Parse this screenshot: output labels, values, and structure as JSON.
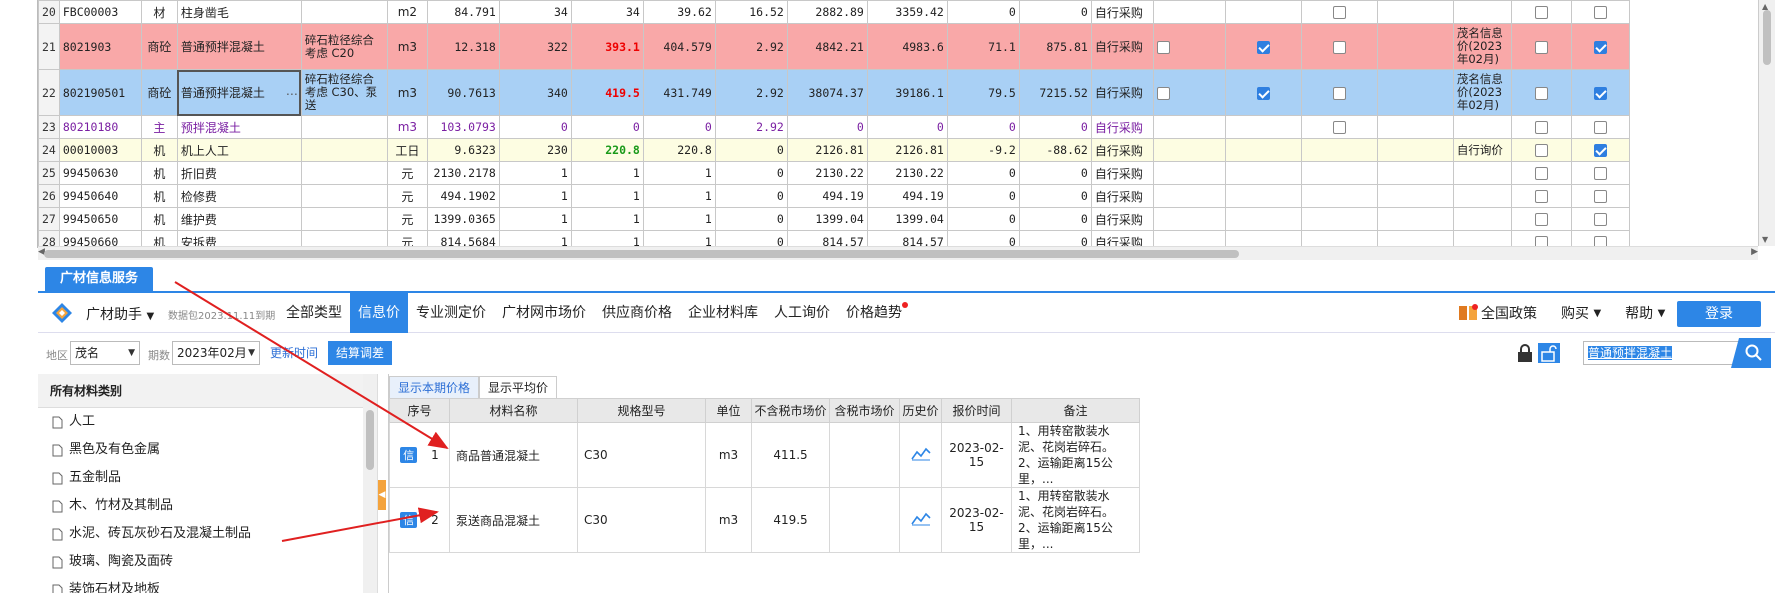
{
  "grid": {
    "rows": [
      {
        "no": "20",
        "code": "FBC00003",
        "type": "材",
        "name": "柱身凿毛",
        "spec": "",
        "unit": "m2",
        "qty": "84.791",
        "c1": "34",
        "c2": "34",
        "c3": "39.62",
        "c4": "16.52",
        "c5": "2882.89",
        "c6": "3359.42",
        "c7": "0",
        "c8": "0",
        "src": "自行采购",
        "ref": "",
        "chk": [
          false,
          false,
          false,
          false,
          false,
          false
        ]
      },
      {
        "no": "21",
        "code": "8021903",
        "type": "商砼",
        "name": "普通预拌混凝土",
        "spec": "碎石粒径综合考虑 C20",
        "unit": "m3",
        "qty": "12.318",
        "c1": "322",
        "c2": "393.1",
        "c3": "404.579",
        "c4": "2.92",
        "c5": "4842.21",
        "c6": "4983.6",
        "c7": "71.1",
        "c8": "875.81",
        "src": "自行采购",
        "ref": "茂名信息价(2023年02月)",
        "chk": [
          false,
          true,
          false,
          false,
          true
        ]
      },
      {
        "no": "22",
        "code": "802190501",
        "type": "商砼",
        "name": "普通预拌混凝土",
        "spec": "碎石粒径综合考虑 C30、泵送",
        "unit": "m3",
        "qty": "90.7613",
        "c1": "340",
        "c2": "419.5",
        "c3": "431.749",
        "c4": "2.92",
        "c5": "38074.37",
        "c6": "39186.1",
        "c7": "79.5",
        "c8": "7215.52",
        "src": "自行采购",
        "ref": "茂名信息价(2023年02月)",
        "chk": [
          false,
          true,
          false,
          false,
          true
        ]
      },
      {
        "no": "23",
        "code": "80210180",
        "type": "主",
        "name": "预拌混凝土",
        "spec": "",
        "unit": "m3",
        "qty": "103.0793",
        "c1": "0",
        "c2": "0",
        "c3": "0",
        "c4": "2.92",
        "c5": "0",
        "c6": "0",
        "c7": "0",
        "c8": "0",
        "src": "自行采购",
        "ref": "",
        "chk": [
          false,
          false
        ]
      },
      {
        "no": "24",
        "code": "00010003",
        "type": "机",
        "name": "机上人工",
        "spec": "",
        "unit": "工日",
        "qty": "9.6323",
        "c1": "230",
        "c2": "220.8",
        "c3": "220.8",
        "c4": "0",
        "c5": "2126.81",
        "c6": "2126.81",
        "c7": "-9.2",
        "c8": "-88.62",
        "src": "自行采购",
        "ref": "自行询价",
        "chk": [
          false,
          true
        ]
      },
      {
        "no": "25",
        "code": "99450630",
        "type": "机",
        "name": "折旧费",
        "spec": "",
        "unit": "元",
        "qty": "2130.2178",
        "c1": "1",
        "c2": "1",
        "c3": "1",
        "c4": "0",
        "c5": "2130.22",
        "c6": "2130.22",
        "c7": "0",
        "c8": "0",
        "src": "自行采购",
        "ref": "",
        "chk": [
          false,
          false
        ]
      },
      {
        "no": "26",
        "code": "99450640",
        "type": "机",
        "name": "检修费",
        "spec": "",
        "unit": "元",
        "qty": "494.1902",
        "c1": "1",
        "c2": "1",
        "c3": "1",
        "c4": "0",
        "c5": "494.19",
        "c6": "494.19",
        "c7": "0",
        "c8": "0",
        "src": "自行采购",
        "ref": "",
        "chk": [
          false,
          false
        ]
      },
      {
        "no": "27",
        "code": "99450650",
        "type": "机",
        "name": "维护费",
        "spec": "",
        "unit": "元",
        "qty": "1399.0365",
        "c1": "1",
        "c2": "1",
        "c3": "1",
        "c4": "0",
        "c5": "1399.04",
        "c6": "1399.04",
        "c7": "0",
        "c8": "0",
        "src": "自行采购",
        "ref": "",
        "chk": [
          false,
          false
        ]
      },
      {
        "no": "28",
        "code": "99450660",
        "type": "机",
        "name": "安拆费",
        "spec": "",
        "unit": "元",
        "qty": "814.5684",
        "c1": "1",
        "c2": "1",
        "c3": "1",
        "c4": "0",
        "c5": "814.57",
        "c6": "814.57",
        "c7": "0",
        "c8": "0",
        "src": "自行采购",
        "ref": "",
        "chk": [
          false,
          false
        ]
      }
    ]
  },
  "panel": {
    "tab_title": "广材信息服务",
    "assistant": "广材助手",
    "expire": "数据包2023.11.11到期",
    "nav": [
      "全部类型",
      "信息价",
      "专业测定价",
      "广材网市场价",
      "供应商价格",
      "企业材料库",
      "人工询价",
      "价格趋势"
    ],
    "right": {
      "policy": "全国政策",
      "buy": "购买",
      "help": "帮助",
      "login": "登录"
    }
  },
  "filter": {
    "region_label": "地区",
    "region": "茂名",
    "period_label": "期数",
    "period": "2023年02月",
    "update_time": "更新时间",
    "settle": "结算调差",
    "search": "普通预拌混凝土"
  },
  "sidebar": {
    "title": "所有材料类别",
    "items": [
      "人工",
      "黑色及有色金属",
      "五金制品",
      "木、竹材及其制品",
      "水泥、砖瓦灰砂石及混凝土制品",
      "玻璃、陶瓷及面砖",
      "装饰石材及地板"
    ]
  },
  "results": {
    "tabs": [
      "显示本期价格",
      "显示平均价"
    ],
    "headers": [
      "序号",
      "材料名称",
      "规格型号",
      "单位",
      "不含税市场价",
      "含税市场价",
      "历史价",
      "报价时间",
      "备注"
    ],
    "badge": "信",
    "rows": [
      {
        "no": "1",
        "name": "商品普通混凝土",
        "spec": "C30",
        "unit": "m3",
        "price_ex": "411.5",
        "price_inc": "",
        "date": "2023-02-15",
        "note1": "1、用转窑散装水泥、花岗岩碎石。",
        "note2": "2、运输距离15公里，..."
      },
      {
        "no": "2",
        "name": "泵送商品混凝土",
        "spec": "C30",
        "unit": "m3",
        "price_ex": "419.5",
        "price_inc": "",
        "date": "2023-02-15",
        "note1": "1、用转窑散装水泥、花岗岩碎石。",
        "note2": "2、运输距离15公里，..."
      }
    ]
  },
  "colors": {
    "accent": "#2d86e6",
    "row_red": "#f9a8a8",
    "row_blue": "#a9d0f5",
    "arrow": "#e02020"
  }
}
